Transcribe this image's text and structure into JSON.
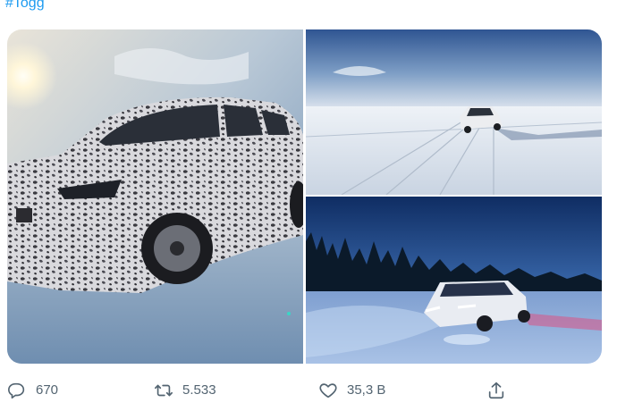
{
  "tweet": {
    "hashtag": "#Togg"
  },
  "media": [
    {
      "icon": "car-photo-closeup",
      "alt": ""
    },
    {
      "icon": "car-photo-road",
      "alt": ""
    },
    {
      "icon": "car-photo-night",
      "alt": ""
    }
  ],
  "actions": {
    "reply": {
      "icon": "reply-icon",
      "count": "670"
    },
    "retweet": {
      "icon": "retweet-icon",
      "count": "5.533"
    },
    "like": {
      "icon": "heart-icon",
      "count": "35,3 B"
    },
    "share": {
      "icon": "share-icon"
    }
  },
  "colors": {
    "link": "#1d9bf0",
    "action_text": "#536471"
  }
}
